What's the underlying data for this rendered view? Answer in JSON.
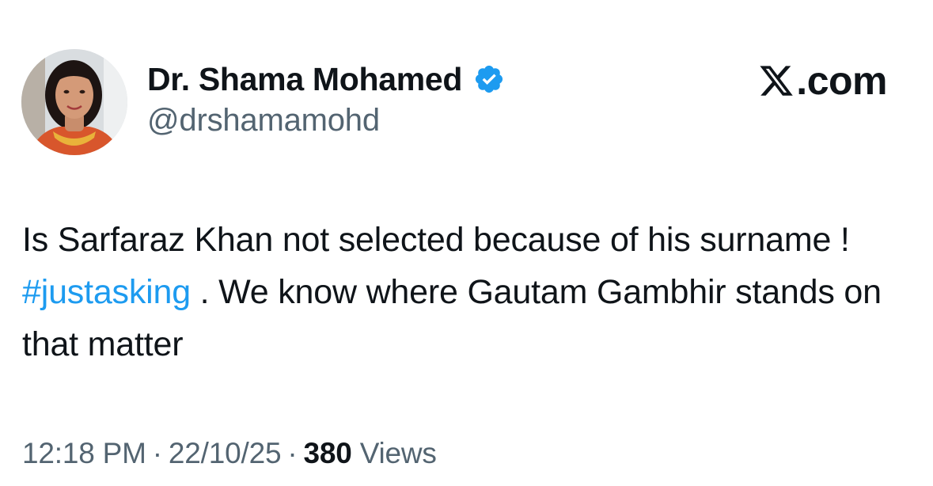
{
  "author": {
    "display_name": "Dr. Shama Mohamed",
    "handle": "@drshamamohd",
    "verified": true,
    "avatar_icon": "profile-photo"
  },
  "brand": {
    "suffix": ".com",
    "icon": "x-logo-icon"
  },
  "tweet": {
    "text_before": "Is Sarfaraz Khan not selected because of his surname ! ",
    "hashtag": "#justasking",
    "text_after": " . We know where Gautam Gambhir stands on that matter"
  },
  "meta": {
    "time": "12:18 PM",
    "separator": "·",
    "date": "22/10/25",
    "views_count": "380",
    "views_label": "Views"
  },
  "colors": {
    "accent": "#1d9bf0",
    "text_primary": "#0f1419",
    "text_secondary": "#536471",
    "background": "#ffffff"
  }
}
